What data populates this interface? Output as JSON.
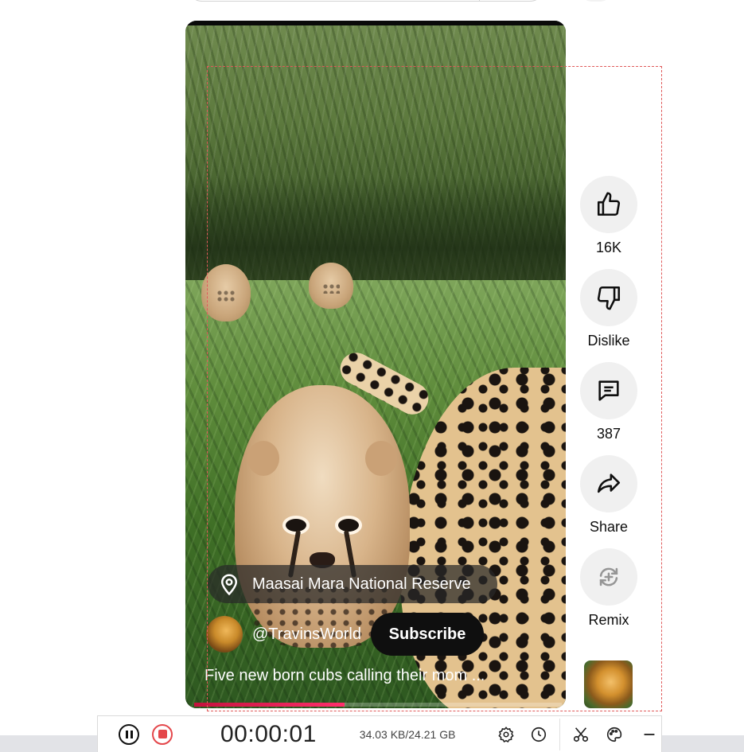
{
  "video": {
    "location": "Maasai Mara National Reserve",
    "channel": "@TravinsWorld",
    "subscribe_label": "Subscribe",
    "title": "Five new born cubs calling their mom ...",
    "progress": 0.41
  },
  "actions": {
    "like": {
      "label": "16K",
      "icon": "thumbs-up-icon"
    },
    "dislike": {
      "label": "Dislike",
      "icon": "thumbs-down-icon"
    },
    "comments": {
      "label": "387",
      "icon": "comment-icon"
    },
    "share": {
      "label": "Share",
      "icon": "share-icon"
    },
    "remix": {
      "label": "Remix",
      "icon": "remix-icon"
    }
  },
  "recorder": {
    "timer": "00:00:01",
    "size": "34.03 KB/24.21 GB",
    "colors": {
      "stop": "#e4474b",
      "capture_border": "#e05a5a",
      "progress": "#ff2e6c"
    }
  }
}
